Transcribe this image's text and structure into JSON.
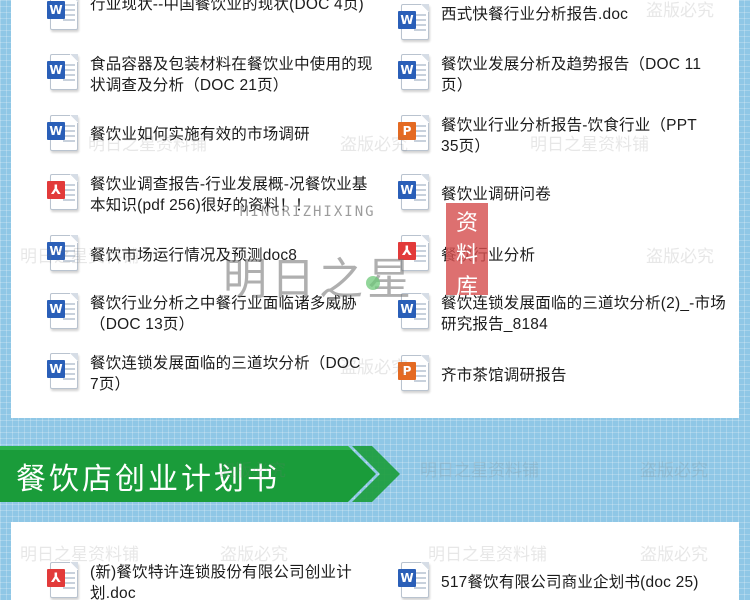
{
  "top_list": [
    {
      "type": "word",
      "icon": "word-file-icon",
      "text": "行业现状--中国餐饮业的现状(DOC 4页)"
    },
    {
      "type": "word",
      "icon": "word-file-icon",
      "text": "西式快餐行业分析报告.doc"
    },
    {
      "type": "word",
      "icon": "word-file-icon",
      "text": "食品容器及包装材料在餐饮业中使用的现状调查及分析（DOC 21页）"
    },
    {
      "type": "word",
      "icon": "word-file-icon",
      "text": "餐饮业发展分析及趋势报告（DOC 11页）"
    },
    {
      "type": "word",
      "icon": "word-file-icon",
      "text": "餐饮业如何实施有效的市场调研"
    },
    {
      "type": "ppt",
      "icon": "ppt-file-icon",
      "text": "餐饮业行业分析报告-饮食行业（PPT 35页）"
    },
    {
      "type": "pdf",
      "icon": "pdf-file-icon",
      "text": "餐饮业调查报告-行业发展概-况餐饮业基本知识(pdf 256)很好的资料！！"
    },
    {
      "type": "word",
      "icon": "word-file-icon",
      "text": "餐饮业调研问卷"
    },
    {
      "type": "word",
      "icon": "word-file-icon",
      "text": "餐饮市场运行情况及预测doc8"
    },
    {
      "type": "pdf",
      "icon": "pdf-file-icon",
      "text": "餐饮行业分析"
    },
    {
      "type": "word",
      "icon": "word-file-icon",
      "text": "餐饮行业分析之中餐行业面临诸多威胁（DOC 13页）"
    },
    {
      "type": "word",
      "icon": "word-file-icon",
      "text": "餐饮连锁发展面临的三道坎分析(2)_-市场研究报告_8184"
    },
    {
      "type": "word",
      "icon": "word-file-icon",
      "text": "餐饮连锁发展面临的三道坎分析（DOC 7页）"
    },
    {
      "type": "ppt",
      "icon": "ppt-file-icon",
      "text": "齐市茶馆调研报告"
    }
  ],
  "section_banner": {
    "title": "餐饮店创业计划书"
  },
  "bottom_list": [
    {
      "type": "pdf",
      "icon": "pdf-file-icon",
      "text": "(新)餐饮特许连锁股份有限公司创业计划.doc"
    },
    {
      "type": "word",
      "icon": "word-file-icon",
      "text": "517餐饮有限公司商业企划书(doc 25)"
    }
  ],
  "watermarks": {
    "brand": "明日之星资料铺",
    "piracy": "盗版必究",
    "logo_text": "明日之星",
    "logo_sub": "MINGRIZHIXING",
    "seal": [
      "资",
      "料",
      "库"
    ]
  },
  "colors": {
    "banner_green": "#1a9c3a",
    "word_blue": "#2a5fb8",
    "ppt_orange": "#e46a22",
    "pdf_red": "#e23a3a",
    "background_blue": "#8fc7e6"
  }
}
